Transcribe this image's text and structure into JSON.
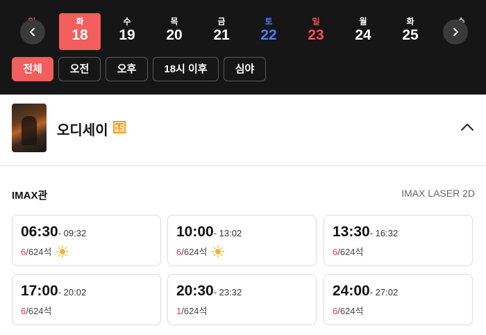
{
  "dates": [
    {
      "dow": "일",
      "num": "",
      "kind": "sun"
    },
    {
      "dow": "화",
      "num": "18",
      "kind": "selected"
    },
    {
      "dow": "수",
      "num": "19",
      "kind": "normal"
    },
    {
      "dow": "목",
      "num": "20",
      "kind": "normal"
    },
    {
      "dow": "금",
      "num": "21",
      "kind": "normal"
    },
    {
      "dow": "토",
      "num": "22",
      "kind": "sat"
    },
    {
      "dow": "일",
      "num": "23",
      "kind": "sun"
    },
    {
      "dow": "월",
      "num": "24",
      "kind": "normal"
    },
    {
      "dow": "화",
      "num": "25",
      "kind": "normal"
    },
    {
      "dow": "수",
      "num": "",
      "kind": "normal"
    }
  ],
  "filters": [
    {
      "label": "전체",
      "active": true
    },
    {
      "label": "오전",
      "active": false
    },
    {
      "label": "오후",
      "active": false
    },
    {
      "label": "18시 이후",
      "active": false
    },
    {
      "label": "심야",
      "active": false
    }
  ],
  "movie": {
    "title": "오디세이",
    "rating": "15"
  },
  "hall": {
    "name": "IMAX관",
    "format": "IMAX LASER 2D"
  },
  "showtimes": [
    {
      "start": "06:30",
      "end": "- 09:32",
      "left": "6",
      "total": "/624석",
      "morning": true
    },
    {
      "start": "10:00",
      "end": "- 13:02",
      "left": "6",
      "total": "/624석",
      "morning": true
    },
    {
      "start": "13:30",
      "end": "- 16:32",
      "left": "6",
      "total": "/624석",
      "morning": false
    },
    {
      "start": "17:00",
      "end": "- 20:02",
      "left": "6",
      "total": "/624석",
      "morning": false
    },
    {
      "start": "20:30",
      "end": "- 23:32",
      "left": "1",
      "total": "/624석",
      "morning": false
    },
    {
      "start": "24:00",
      "end": "- 27:02",
      "left": "6",
      "total": "/624석",
      "morning": false
    }
  ],
  "colors": {
    "accent": "#f25d5d",
    "saturday": "#4b7bff",
    "sunday": "#ff4f4f",
    "rating": "#f29a1a",
    "topbar": "#161616"
  },
  "icons": {
    "prev": "chevron-left-icon",
    "next": "chevron-right-icon",
    "collapse": "chevron-up-icon",
    "morning": "sun-icon"
  }
}
